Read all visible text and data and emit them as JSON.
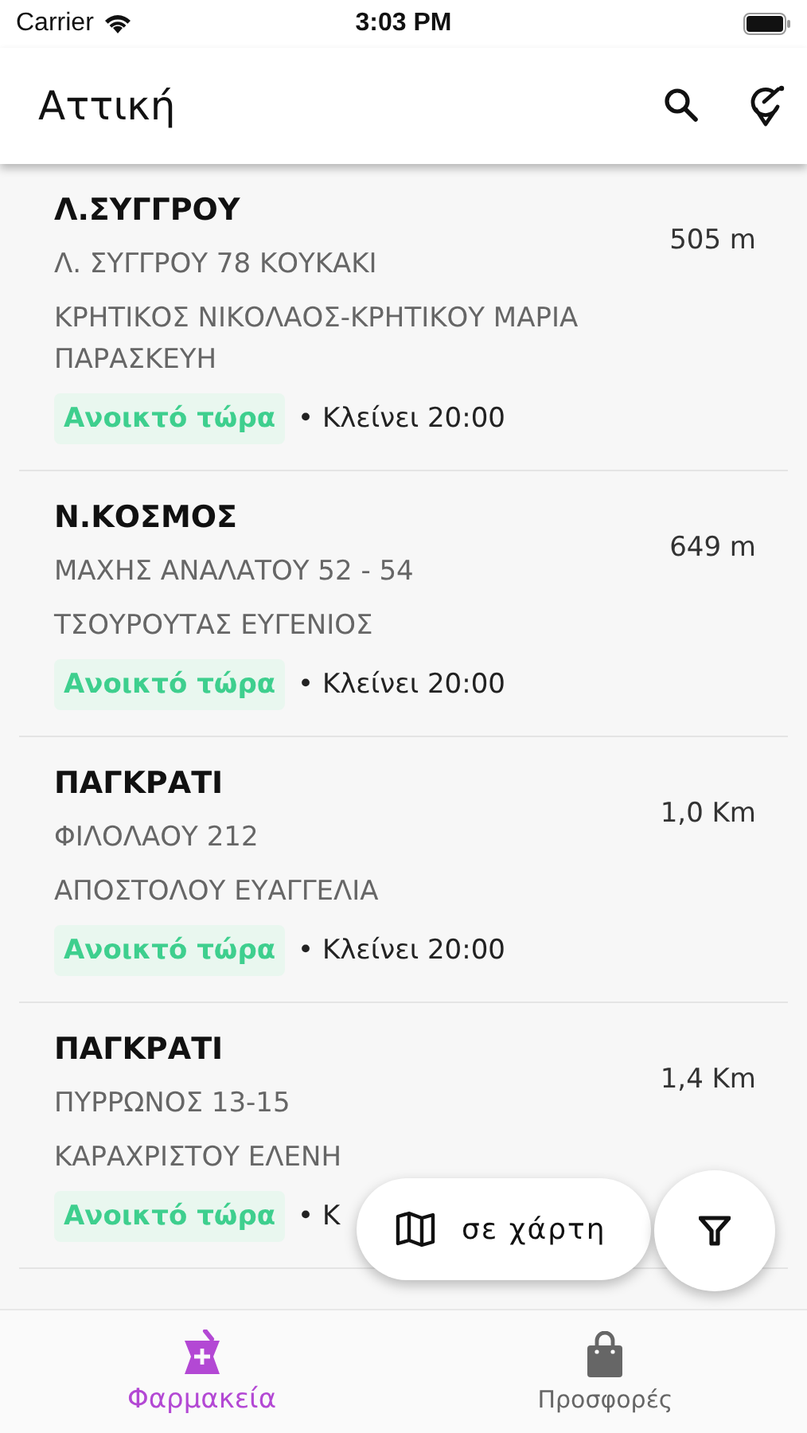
{
  "status_bar": {
    "carrier": "Carrier",
    "time": "3:03 PM"
  },
  "header": {
    "title": "Αττική"
  },
  "pharmacies": [
    {
      "name": "Λ.ΣΥΓΓΡΟΥ",
      "address": "Λ. ΣΥΓΓΡΟΥ 78 ΚΟΥΚΑΚΙ",
      "owner": "ΚΡΗΤΙΚΟΣ ΝΙΚΟΛΑΟΣ-ΚΡΗΤΙΚΟΥ ΜΑΡΙΑ ΠΑΡΑΣΚΕΥΗ",
      "status": "Ανοικτό τώρα",
      "closing": "• Κλείνει 20:00",
      "distance": "505 m"
    },
    {
      "name": "Ν.ΚΟΣΜΟΣ",
      "address": "ΜΑΧΗΣ ΑΝΑΛΑΤΟΥ 52 - 54",
      "owner": "ΤΣΟΥΡΟΥΤΑΣ ΕΥΓΕΝΙΟΣ",
      "status": "Ανοικτό τώρα",
      "closing": "• Κλείνει 20:00",
      "distance": "649 m"
    },
    {
      "name": "ΠΑΓΚΡΑΤΙ",
      "address": "ΦΙΛΟΛΑΟΥ 212",
      "owner": "ΑΠΟΣΤΟΛΟΥ ΕΥΑΓΓΕΛΙΑ",
      "status": "Ανοικτό τώρα",
      "closing": "• Κλείνει 20:00",
      "distance": "1,0 Km"
    },
    {
      "name": "ΠΑΓΚΡΑΤΙ",
      "address": "ΠΥΡΡΩΝΟΣ 13-15",
      "owner": "ΚΑΡΑΧΡΙΣΤΟΥ ΕΛΕΝΗ",
      "status": "Ανοικτό τώρα",
      "closing": "• Κ",
      "distance": "1,4 Km"
    }
  ],
  "map_button": {
    "label": "σε χάρτη"
  },
  "tabs": [
    {
      "label": "Φαρμακεία",
      "kind": "pharmacy",
      "selected": true
    },
    {
      "label": "Προσφορές",
      "kind": "offers",
      "selected": false
    }
  ]
}
